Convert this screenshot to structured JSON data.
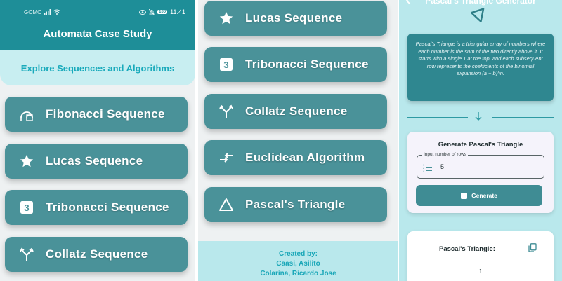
{
  "colors": {
    "primary": "#1e8e98",
    "button": "#4a9299",
    "accent_text": "#19aabb",
    "light_bg": "#b9e8ec"
  },
  "screen1": {
    "status": {
      "carrier": "GOMO",
      "battery": "100",
      "time": "11:41"
    },
    "title": "Automata Case Study",
    "subtitle": "Explore Sequences and Algorithms",
    "menu": [
      {
        "label": "Fibonacci Sequence",
        "icon": "fibonacci-spiral-icon"
      },
      {
        "label": "Lucas Sequence",
        "icon": "star-icon"
      },
      {
        "label": "Tribonacci Sequence",
        "icon": "number-3-icon"
      },
      {
        "label": "Collatz Sequence",
        "icon": "fork-icon"
      }
    ]
  },
  "screen2": {
    "menu": [
      {
        "label": "Lucas Sequence",
        "icon": "star-icon"
      },
      {
        "label": "Tribonacci Sequence",
        "icon": "number-3-icon"
      },
      {
        "label": "Collatz Sequence",
        "icon": "fork-icon"
      },
      {
        "label": "Euclidean Algorithm",
        "icon": "compare-arrows-icon"
      },
      {
        "label": "Pascal's Triangle",
        "icon": "triangle-icon"
      }
    ],
    "credits": {
      "heading": "Created by:",
      "names": [
        "Caasi, Asilito",
        "Colarina, Ricardo Jose"
      ]
    }
  },
  "screen3": {
    "title": "Pascal's Triangle Generator",
    "description": "Pascal's Triangle is a triangular array of numbers where each number is the sum of the two directly above it. It starts with a single 1 at the top, and each subsequent row represents the coefficients of the binomial expansion (a + b)^n.",
    "form": {
      "title": "Generate Pascal's Triangle",
      "input_label": "Input number of rows",
      "input_value": "5",
      "button_label": "Generate"
    },
    "result": {
      "title": "Pascal's Triangle:",
      "rows": [
        "1"
      ]
    }
  }
}
